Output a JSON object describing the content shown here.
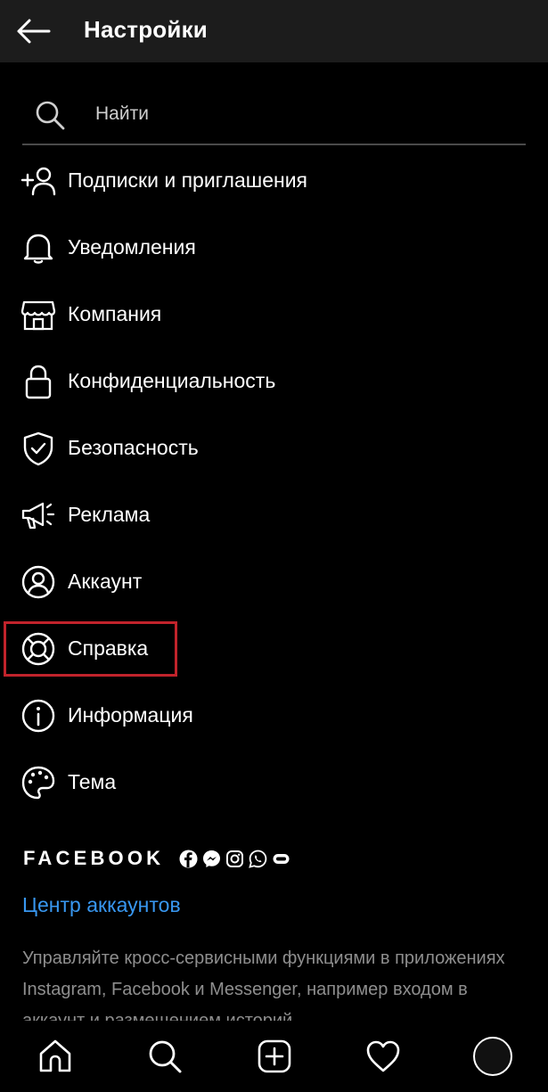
{
  "header": {
    "title": "Настройки"
  },
  "search": {
    "placeholder": "Найти"
  },
  "menu": {
    "items": [
      {
        "label": "Подписки и приглашения",
        "icon": "add-person-icon"
      },
      {
        "label": "Уведомления",
        "icon": "bell-icon"
      },
      {
        "label": "Компания",
        "icon": "shop-icon"
      },
      {
        "label": "Конфиденциальность",
        "icon": "lock-icon"
      },
      {
        "label": "Безопасность",
        "icon": "shield-icon"
      },
      {
        "label": "Реклама",
        "icon": "megaphone-icon"
      },
      {
        "label": "Аккаунт",
        "icon": "account-icon"
      },
      {
        "label": "Справка",
        "icon": "lifebuoy-icon"
      },
      {
        "label": "Информация",
        "icon": "info-icon"
      },
      {
        "label": "Тема",
        "icon": "palette-icon"
      }
    ]
  },
  "facebook": {
    "brand": "FACEBOOK",
    "accounts_center": "Центр аккаунтов",
    "description": "Управляйте кросс-сервисными функциями в приложениях Instagram, Facebook и Messenger, например входом в аккаунт и размещением историй"
  },
  "colors": {
    "link": "#3897f0",
    "highlight": "#c1232b",
    "header_bg": "#1c1c1c"
  },
  "bottom_nav": [
    "home-icon",
    "search-icon",
    "new-post-icon",
    "heart-icon",
    "profile-avatar"
  ]
}
